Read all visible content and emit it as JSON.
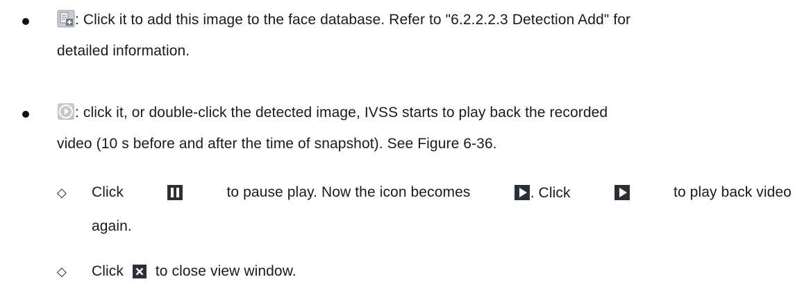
{
  "bullets": [
    {
      "icon": "add-to-database-icon",
      "line1_part1": ": Click it to add this image to the face database. Refer to \"6.2.2.2.3 Detection Add\" for",
      "line2": "detailed information."
    },
    {
      "icon": "playback-icon",
      "line1_part1": ": click it, or double-click the detected image, IVSS starts to play back the recorded",
      "line2": "video (10 s before and after the time of snapshot). See Figure 6-36."
    }
  ],
  "sub_items": [
    {
      "marker": "◇",
      "text_click": "Click",
      "pause_icon": "pause-icon",
      "text_mid": "to pause play. Now the icon becomes",
      "play_icon": "play-icon",
      "text_click2": ". Click",
      "text_end": "to play back video",
      "line2": "again."
    },
    {
      "marker": "◇",
      "text_click": "Click",
      "close_icon": "close-icon",
      "text_end": "to close view window."
    }
  ],
  "colors": {
    "text": "#1a1a1a",
    "icon_dark": "#2b2f36",
    "icon_grey": "#b9bcc2"
  }
}
